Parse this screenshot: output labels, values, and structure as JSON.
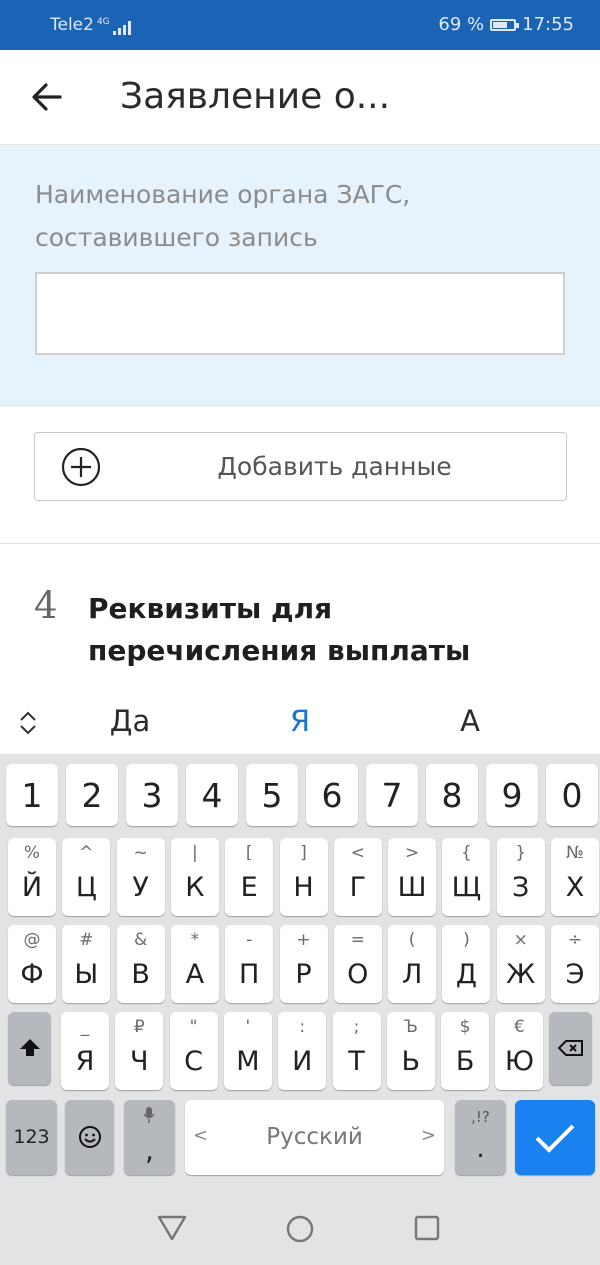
{
  "status": {
    "carrier": "Tele2",
    "network": "4G",
    "battery_level": 0.69,
    "battery_text": "69 %",
    "time": "17:55"
  },
  "appbar": {
    "title": "Заявление о..."
  },
  "form": {
    "field_label": "Наименование органа ЗАГС, составившего запись",
    "field_value": ""
  },
  "add_button": {
    "label": "Добавить данные"
  },
  "section": {
    "number": "4",
    "title": "Реквизиты для перечисления выплаты"
  },
  "suggestions": [
    "Да",
    "Я",
    "А"
  ],
  "keyboard": {
    "digits": [
      "1",
      "2",
      "3",
      "4",
      "5",
      "6",
      "7",
      "8",
      "9",
      "0"
    ],
    "row1": [
      {
        "main": "Й",
        "sub": "%"
      },
      {
        "main": "Ц",
        "sub": "^"
      },
      {
        "main": "У",
        "sub": "~"
      },
      {
        "main": "К",
        "sub": "|"
      },
      {
        "main": "Е",
        "sub": "["
      },
      {
        "main": "Н",
        "sub": "]"
      },
      {
        "main": "Г",
        "sub": "<"
      },
      {
        "main": "Ш",
        "sub": ">"
      },
      {
        "main": "Щ",
        "sub": "{"
      },
      {
        "main": "З",
        "sub": "}"
      },
      {
        "main": "Х",
        "sub": "№"
      }
    ],
    "row2": [
      {
        "main": "Ф",
        "sub": "@"
      },
      {
        "main": "Ы",
        "sub": "#"
      },
      {
        "main": "В",
        "sub": "&"
      },
      {
        "main": "А",
        "sub": "*"
      },
      {
        "main": "П",
        "sub": "-"
      },
      {
        "main": "Р",
        "sub": "+"
      },
      {
        "main": "О",
        "sub": "="
      },
      {
        "main": "Л",
        "sub": "("
      },
      {
        "main": "Д",
        "sub": ")"
      },
      {
        "main": "Ж",
        "sub": "×"
      },
      {
        "main": "Э",
        "sub": "÷"
      }
    ],
    "row3": [
      {
        "main": "Я",
        "sub": "_"
      },
      {
        "main": "Ч",
        "sub": "₽"
      },
      {
        "main": "С",
        "sub": "\""
      },
      {
        "main": "М",
        "sub": "'"
      },
      {
        "main": "И",
        "sub": ":"
      },
      {
        "main": "Т",
        "sub": ";"
      },
      {
        "main": "Ь",
        "sub": "Ъ"
      },
      {
        "main": "Б",
        "sub": "$"
      },
      {
        "main": "Ю",
        "sub": "€"
      }
    ],
    "symbols_key": "123",
    "comma_key": ",",
    "space_label": "Русский",
    "space_left": "<",
    "space_right": ">",
    "period_key": ".",
    "period_sub": ",!?",
    "enter_color": "#1a82f0"
  }
}
